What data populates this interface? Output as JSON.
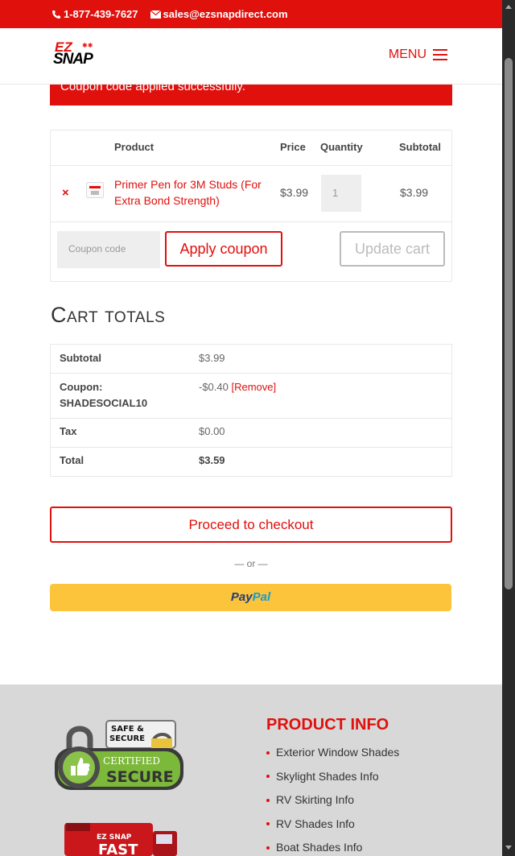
{
  "topbar": {
    "phone": "1-877-439-7627",
    "email": "sales@ezsnapdirect.com"
  },
  "header": {
    "logo_ez": "EZ",
    "logo_snap": "SNAP",
    "menu_label": "MENU"
  },
  "notice": {
    "text": "Coupon code applied successfully."
  },
  "cart": {
    "headers": {
      "product": "Product",
      "price": "Price",
      "quantity": "Quantity",
      "subtotal": "Subtotal"
    },
    "item": {
      "remove": "×",
      "name": "Primer Pen for 3M Studs (For Extra Bond Strength)",
      "price": "$3.99",
      "quantity": "1",
      "subtotal": "$3.99"
    },
    "coupon_placeholder": "Coupon code",
    "apply_label": "Apply coupon",
    "update_label": "Update cart"
  },
  "totals": {
    "title": "Cart totals",
    "subtotal_label": "Subtotal",
    "subtotal_value": "$3.99",
    "coupon_label_1": "Coupon:",
    "coupon_label_2": "SHADESOCIAL10",
    "coupon_value": "-$0.40",
    "coupon_remove": "[Remove]",
    "tax_label": "Tax",
    "tax_value": "$0.00",
    "total_label": "Total",
    "total_value": "$3.59"
  },
  "checkout": {
    "proceed_label": "Proceed to checkout",
    "or_text": "— or —",
    "paypal_1": "Pay",
    "paypal_2": "Pal"
  },
  "footer": {
    "badge_line1": "SAFE &",
    "badge_line2": "SECURE",
    "badge_line3": "CERTIFIED",
    "badge_line4": "SECURE",
    "truck_text": "FAST",
    "title": "PRODUCT INFO",
    "links": [
      "Exterior Window Shades",
      "Skylight Shades Info",
      "RV Skirting Info",
      "RV Shades Info",
      "Boat Shades Info"
    ]
  },
  "colors": {
    "brand_red": "#e0100d",
    "paypal_yellow": "#fbc43a",
    "footer_gray": "#d8d8d8"
  }
}
